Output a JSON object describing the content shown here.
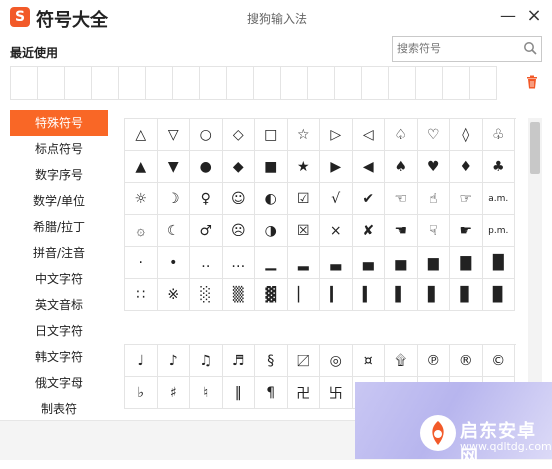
{
  "window": {
    "app_title": "符号大全",
    "logo_text": "S",
    "center_title": "搜狗输入法",
    "minimize": "—",
    "close": "×"
  },
  "recent": {
    "label": "最近使用",
    "cells": 18
  },
  "search": {
    "placeholder": "搜索符号"
  },
  "sidebar": {
    "items": [
      {
        "label": "特殊符号"
      },
      {
        "label": "标点符号"
      },
      {
        "label": "数字序号"
      },
      {
        "label": "数学/单位"
      },
      {
        "label": "希腊/拉丁"
      },
      {
        "label": "拼音/注音"
      },
      {
        "label": "中文字符"
      },
      {
        "label": "英文音标"
      },
      {
        "label": "日文字符"
      },
      {
        "label": "韩文字符"
      },
      {
        "label": "俄文字母"
      },
      {
        "label": "制表符"
      }
    ]
  },
  "special_symbols": [
    [
      "△",
      "▽",
      "○",
      "◇",
      "□",
      "☆",
      "▷",
      "◁",
      "♤",
      "♡",
      "◊",
      "♧"
    ],
    [
      "▲",
      "▼",
      "●",
      "◆",
      "■",
      "★",
      "▶",
      "◀",
      "♠",
      "♥",
      "♦",
      "♣"
    ],
    [
      "☼",
      "☽",
      "♀",
      "☺",
      "◐",
      "☑",
      "√",
      "✔",
      "☜",
      "☝",
      "☞",
      "a.m."
    ],
    [
      "۞",
      "☾",
      "♂",
      "☹",
      "◑",
      "☒",
      "×",
      "✘",
      "☚",
      "☟",
      "☛",
      "p.m."
    ],
    [
      "·",
      "•",
      "‥",
      "…",
      "▁",
      "▂",
      "▃",
      "▄",
      "▅",
      "▆",
      "▇",
      "█"
    ],
    [
      "∷",
      "※",
      "░",
      "▒",
      "▓",
      "▏",
      "▎",
      "▍",
      "▌",
      "▋",
      "▊",
      "▉"
    ]
  ],
  "music_symbols": [
    [
      "♩",
      "♪",
      "♫",
      "♬",
      "§",
      "〼",
      "◎",
      "¤",
      "۩",
      "℗",
      "®",
      "©"
    ],
    [
      "♭",
      "♯",
      "♮",
      "‖",
      "¶",
      "卍",
      "卐",
      "",
      "",
      "",
      "",
      ""
    ]
  ],
  "watermark": {
    "title": "启东安卓网",
    "url": "www.qdltdg.com"
  },
  "colors": {
    "accent": "#f96726",
    "logo": "#f25a29",
    "border": "#e4e4e4"
  }
}
